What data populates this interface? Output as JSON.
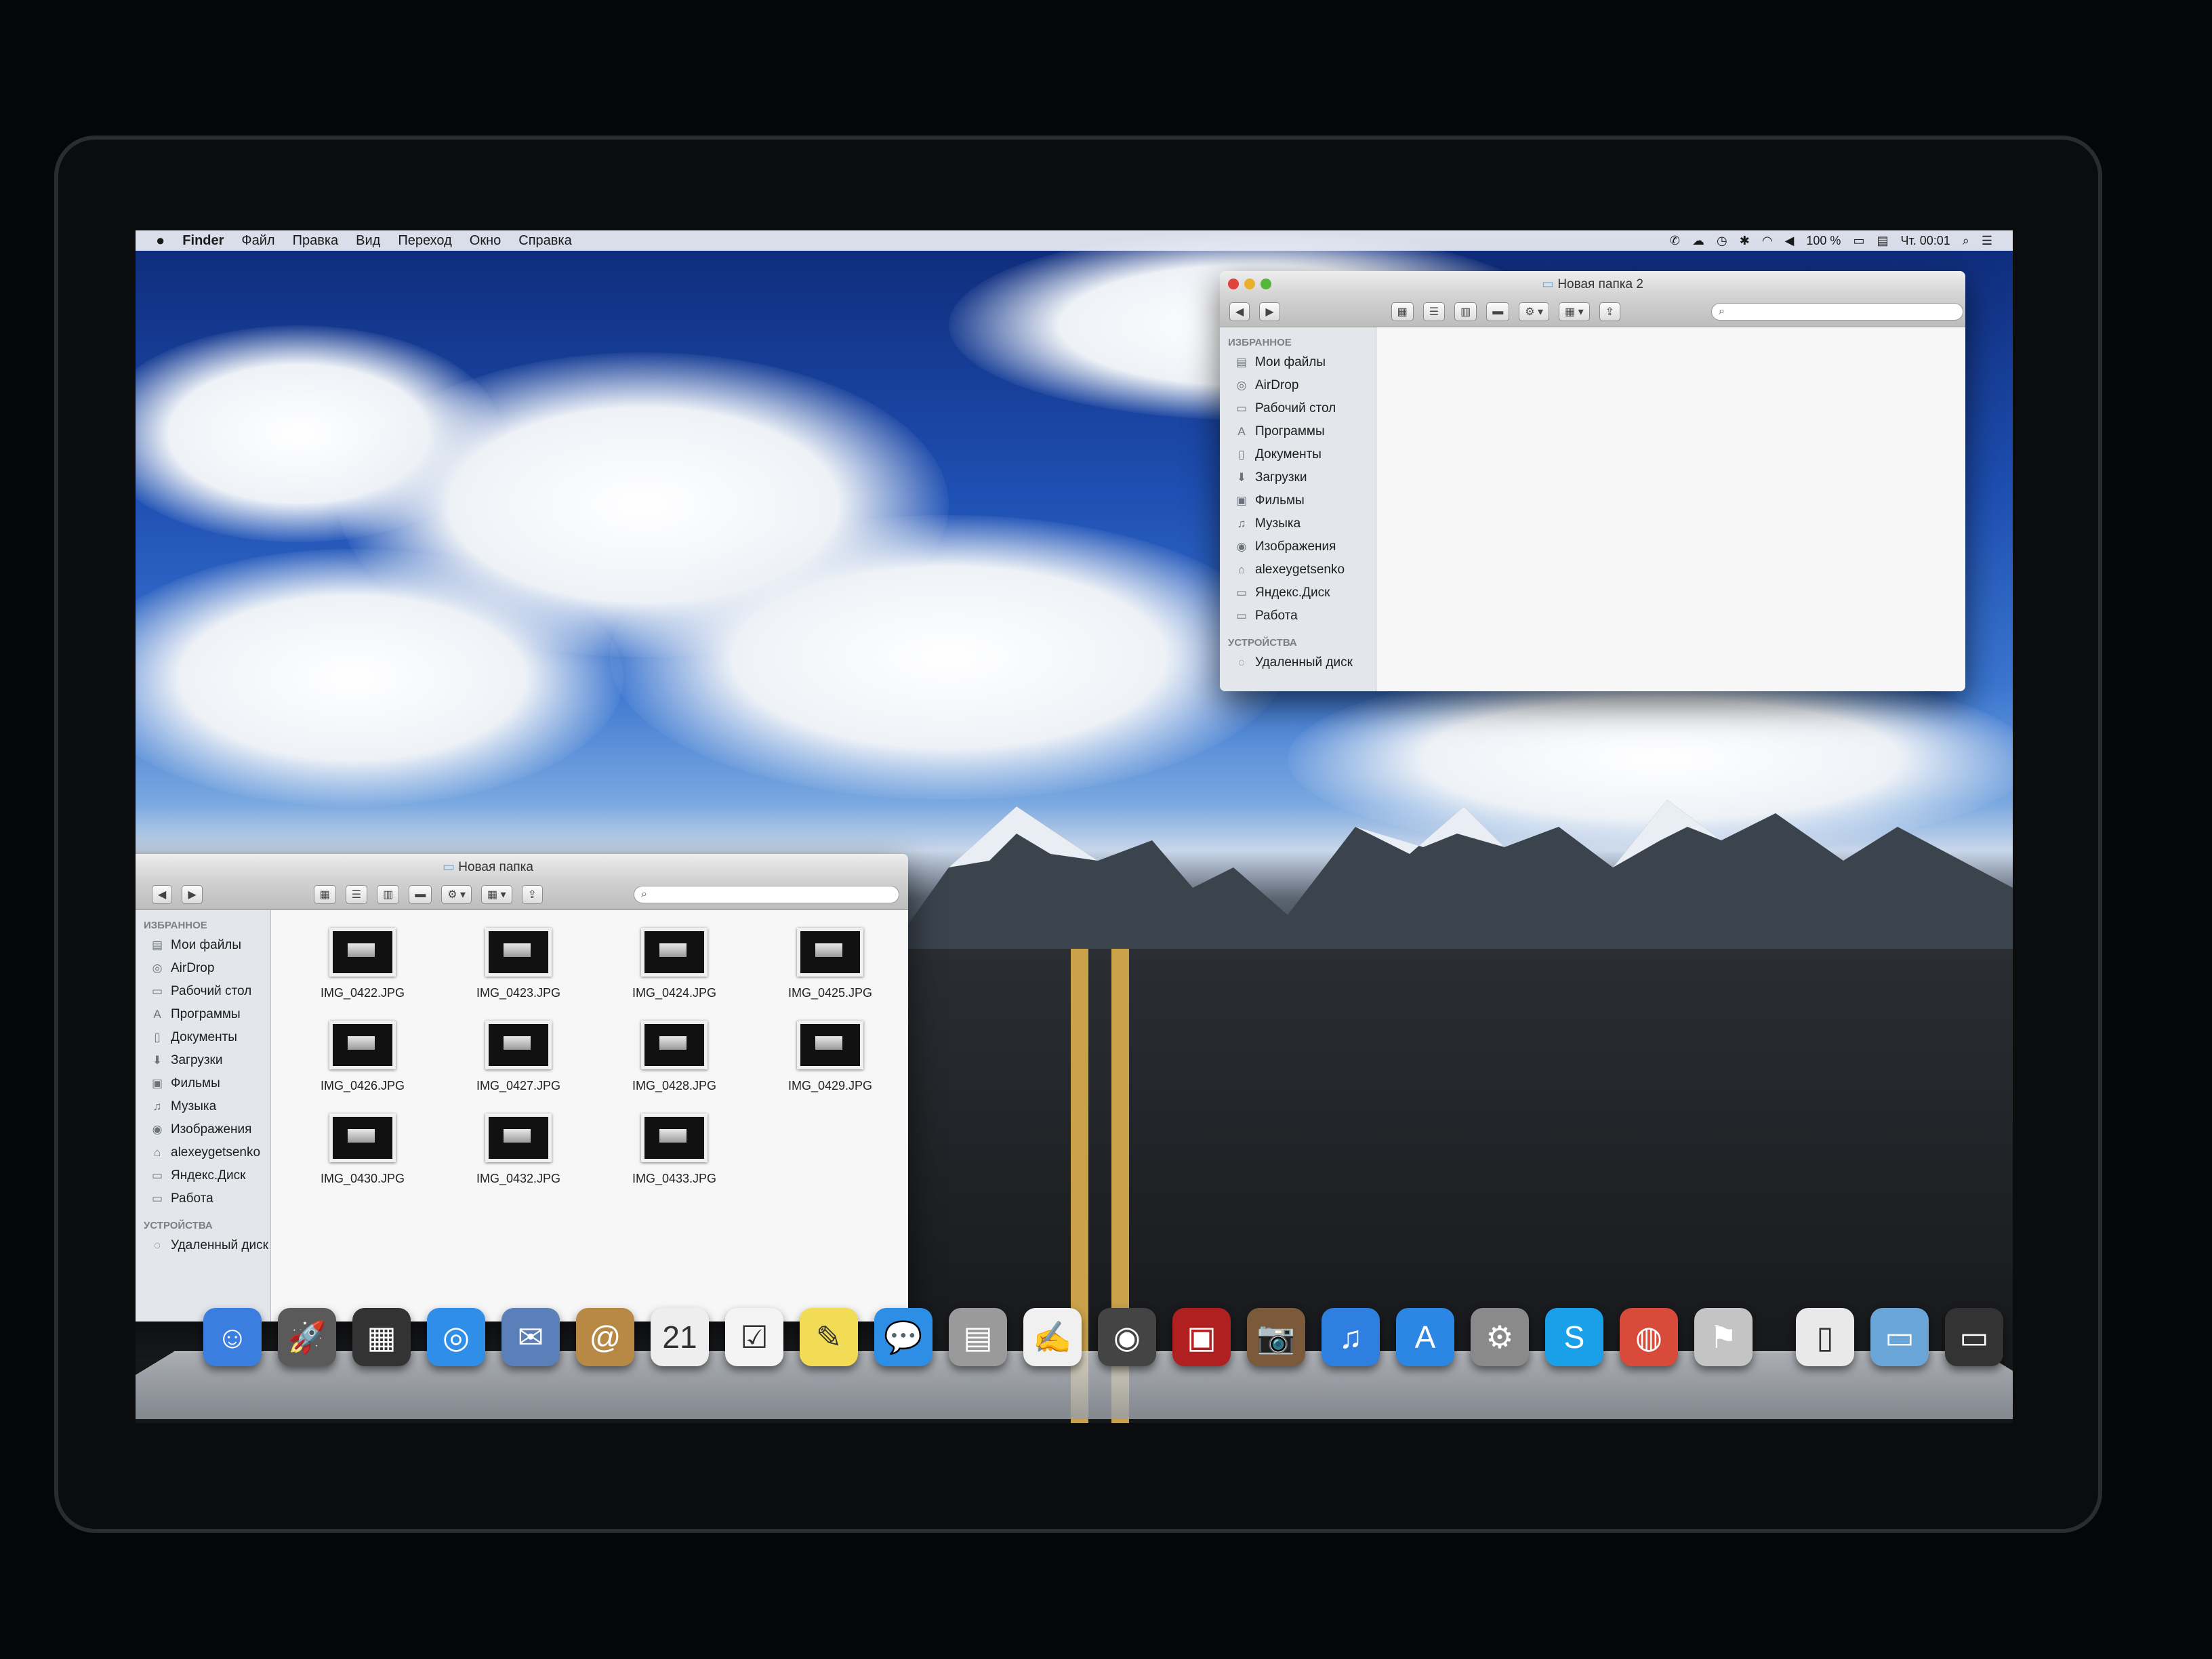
{
  "menubar": {
    "apple": "",
    "items": [
      "Finder",
      "Файл",
      "Правка",
      "Вид",
      "Переход",
      "Окно",
      "Справка"
    ],
    "battery": "100 %",
    "clock": "Чт. 00:01"
  },
  "window_right": {
    "title": "Новая папка 2",
    "sections": {
      "favorites": "ИЗБРАННОЕ",
      "devices": "УСТРОЙСТВА"
    },
    "favorites": [
      {
        "label": "Мои файлы",
        "icon": "all-files-icon"
      },
      {
        "label": "AirDrop",
        "icon": "airdrop-icon"
      },
      {
        "label": "Рабочий стол",
        "icon": "desktop-icon"
      },
      {
        "label": "Программы",
        "icon": "applications-icon"
      },
      {
        "label": "Документы",
        "icon": "documents-icon"
      },
      {
        "label": "Загрузки",
        "icon": "downloads-icon"
      },
      {
        "label": "Фильмы",
        "icon": "movies-icon"
      },
      {
        "label": "Музыка",
        "icon": "music-icon"
      },
      {
        "label": "Изображения",
        "icon": "pictures-icon"
      },
      {
        "label": "alexeygetsenko",
        "icon": "home-icon"
      },
      {
        "label": "Яндекс.Диск",
        "icon": "folder-icon"
      },
      {
        "label": "Работа",
        "icon": "folder-icon"
      }
    ],
    "devices": [
      {
        "label": "Удаленный диск",
        "icon": "remote-disc-icon"
      }
    ]
  },
  "window_left": {
    "title": "Новая папка",
    "sections": {
      "favorites": "ИЗБРАННОЕ",
      "devices": "УСТРОЙСТВА"
    },
    "favorites": [
      {
        "label": "Мои файлы",
        "icon": "all-files-icon"
      },
      {
        "label": "AirDrop",
        "icon": "airdrop-icon"
      },
      {
        "label": "Рабочий стол",
        "icon": "desktop-icon"
      },
      {
        "label": "Программы",
        "icon": "applications-icon"
      },
      {
        "label": "Документы",
        "icon": "documents-icon"
      },
      {
        "label": "Загрузки",
        "icon": "downloads-icon"
      },
      {
        "label": "Фильмы",
        "icon": "movies-icon"
      },
      {
        "label": "Музыка",
        "icon": "music-icon"
      },
      {
        "label": "Изображения",
        "icon": "pictures-icon"
      },
      {
        "label": "alexeygetsenko",
        "icon": "home-icon"
      },
      {
        "label": "Яндекс.Диск",
        "icon": "folder-icon"
      },
      {
        "label": "Работа",
        "icon": "folder-icon"
      }
    ],
    "devices": [
      {
        "label": "Удаленный диск",
        "icon": "remote-disc-icon"
      }
    ],
    "files": [
      "IMG_0422.JPG",
      "IMG_0423.JPG",
      "IMG_0424.JPG",
      "IMG_0425.JPG",
      "IMG_0426.JPG",
      "IMG_0427.JPG",
      "IMG_0428.JPG",
      "IMG_0429.JPG",
      "IMG_0430.JPG",
      "IMG_0432.JPG",
      "IMG_0433.JPG"
    ]
  },
  "dock": {
    "items": [
      {
        "name": "finder-icon",
        "glyph": "☺",
        "color": "#3a7fe0"
      },
      {
        "name": "launchpad-icon",
        "glyph": "🚀",
        "color": "#5a5a5a"
      },
      {
        "name": "mission-control-icon",
        "glyph": "▦",
        "color": "#333"
      },
      {
        "name": "safari-icon",
        "glyph": "◎",
        "color": "#2f8fe8"
      },
      {
        "name": "mail-icon",
        "glyph": "✉",
        "color": "#5b7fb8"
      },
      {
        "name": "contacts-icon",
        "glyph": "@",
        "color": "#b78945"
      },
      {
        "name": "calendar-icon",
        "glyph": "21",
        "color": "#eeeeee"
      },
      {
        "name": "reminders-icon",
        "glyph": "☑",
        "color": "#f4f4f4"
      },
      {
        "name": "notes-icon",
        "glyph": "✎",
        "color": "#f3dc55"
      },
      {
        "name": "messages-icon",
        "glyph": "💬",
        "color": "#2d8ee6"
      },
      {
        "name": "calculator-icon",
        "glyph": "▤",
        "color": "#9a9a9a"
      },
      {
        "name": "textedit-icon",
        "glyph": "✍",
        "color": "#f0f0f0"
      },
      {
        "name": "facetime-icon",
        "glyph": "◉",
        "color": "#444"
      },
      {
        "name": "photo-booth-icon",
        "glyph": "▣",
        "color": "#b02020"
      },
      {
        "name": "iphoto-icon",
        "glyph": "📷",
        "color": "#7a5a3a"
      },
      {
        "name": "itunes-icon",
        "glyph": "♫",
        "color": "#2f7fe0"
      },
      {
        "name": "app-store-icon",
        "glyph": "A",
        "color": "#2b86e4"
      },
      {
        "name": "system-preferences-icon",
        "glyph": "⚙",
        "color": "#8a8a8a"
      },
      {
        "name": "skype-icon",
        "glyph": "S",
        "color": "#1aa0e8"
      },
      {
        "name": "chrome-icon",
        "glyph": "◍",
        "color": "#d84a3a"
      },
      {
        "name": "automator-icon",
        "glyph": "⚑",
        "color": "#c4c4c4"
      },
      {
        "name": "document-icon",
        "glyph": "▯",
        "color": "#e9e9e9"
      },
      {
        "name": "folder-stack-icon",
        "glyph": "▭",
        "color": "#6aa5d8"
      },
      {
        "name": "screenshot-stack-icon",
        "glyph": "▭",
        "color": "#333"
      },
      {
        "name": "trash-icon",
        "glyph": "⌫",
        "color": "#9aa0a6"
      }
    ]
  },
  "colors": {
    "close": "#e0433b",
    "minimize": "#e8b12c",
    "zoom": "#53b53a"
  }
}
